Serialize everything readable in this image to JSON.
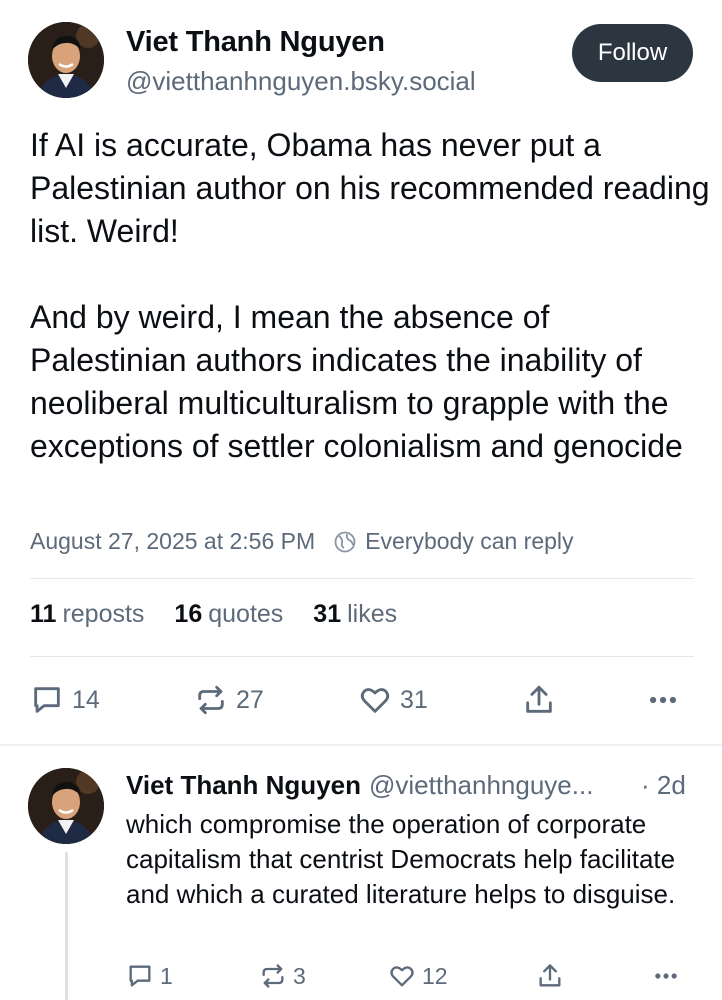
{
  "post": {
    "author_name": "Viet Thanh Nguyen",
    "author_handle": "@vietthanhnguyen.bsky.social",
    "follow_label": "Follow",
    "text": "If AI is accurate, Obama has never put a Palestinian author on his recommended reading list. Weird!\n\nAnd by weird, I mean the absence of Palestinian authors indicates the inability of neoliberal multiculturalism to grapple with the exceptions of settler colonialism and genocide",
    "timestamp": "August 27, 2025 at 2:56 PM",
    "reply_setting": "Everybody can reply",
    "reposts_count": "11",
    "reposts_label": "reposts",
    "quotes_count": "16",
    "quotes_label": "quotes",
    "likes_count": "31",
    "likes_label": "likes",
    "actions": {
      "reply_count": "14",
      "repost_count": "27",
      "like_count": "31"
    }
  },
  "reply": {
    "author_name": "Viet Thanh Nguyen",
    "author_handle": "@vietthanhnguye...",
    "time": "· 2d",
    "text": "which compromise the operation of corporate capitalism that centrist Democrats help facilitate and which a curated literature helps to disguise.",
    "actions": {
      "reply_count": "1",
      "repost_count": "3",
      "like_count": "12"
    }
  },
  "icons": [
    "avatar",
    "globe-icon",
    "reply-icon",
    "repost-icon",
    "like-icon",
    "share-icon",
    "more-icon"
  ],
  "colors": {
    "follow_bg": "#2b3640",
    "muted_text": "#5c6a7a",
    "text": "#0b0f14"
  }
}
